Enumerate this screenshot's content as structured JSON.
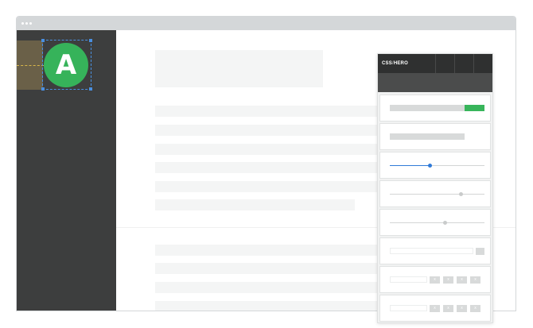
{
  "app": {
    "logo_letter": "A",
    "panel_brand": "CSS",
    "panel_brand_suffix": "HERO",
    "panel_separator": "/",
    "stepper_labels": [
      "x",
      "x",
      "x",
      "x"
    ],
    "accent_green": "#36b35a",
    "selection_blue": "#4a8fe0",
    "slider_value": 0.4
  }
}
